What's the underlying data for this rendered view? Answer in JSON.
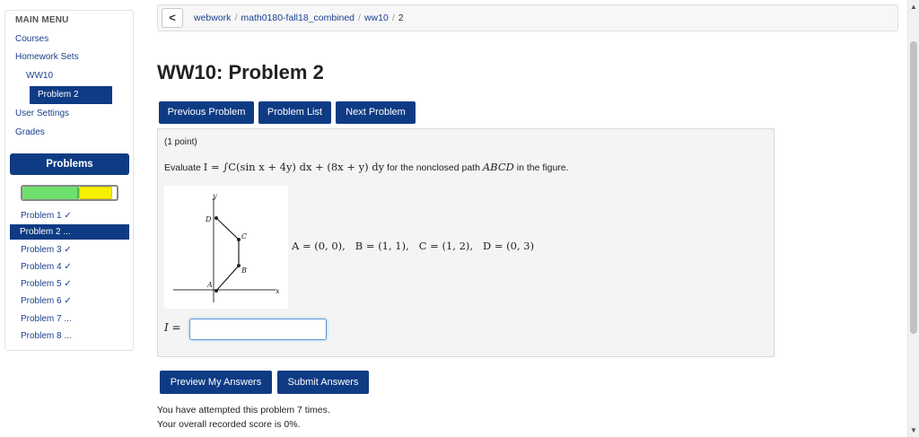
{
  "sidebar": {
    "menu_header": "MAIN MENU",
    "courses": "Courses",
    "homework_sets": "Homework Sets",
    "ww10": "WW10",
    "problem_active": "Problem 2",
    "user_settings": "User Settings",
    "grades": "Grades",
    "problems_header": "Problems",
    "progress": {
      "correct_fraction": 0.6,
      "attempted_fraction": 0.35,
      "correct_color": "#6ee06e",
      "attempted_color": "#f9f000"
    },
    "problems": [
      "Problem 1 ✓",
      "Problem 2 ...",
      "Problem 3 ✓",
      "Problem 4 ✓",
      "Problem 5 ✓",
      "Problem 6 ✓",
      "Problem 7 ...",
      "Problem 8 ..."
    ]
  },
  "breadcrumb": {
    "back_icon": "chevron-left-icon",
    "back_glyph": "<",
    "items": [
      "webwork",
      "math0180-fall18_combined",
      "ww10",
      "2"
    ],
    "separator": "/"
  },
  "page_title": "WW10: Problem 2",
  "nav": {
    "previous": "Previous Problem",
    "list": "Problem List",
    "next": "Next Problem"
  },
  "problem": {
    "points": "(1 point)",
    "statement_prefix": "Evaluate ",
    "statement_suffix": " for the nonclosed path ",
    "statement_end": " in the figure.",
    "math_integral": "I = ∫C(sin x + 4y) dx + (8x + y) dy",
    "path_name": "ABCD",
    "points_text": "A = (0, 0),   B = (1, 1),   C = (1, 2),   D = (0, 3)",
    "figure_labels": {
      "y_axis": "y",
      "x_axis": "x",
      "A": "A",
      "B": "B",
      "C": "C",
      "D": "D"
    },
    "answer_label": "I =",
    "answer_value": ""
  },
  "actions": {
    "preview": "Preview My Answers",
    "submit": "Submit Answers"
  },
  "status": {
    "attempts": "You have attempted this problem 7 times.",
    "score": "Your overall recorded score is 0%."
  },
  "colors": {
    "primary": "#0e3b84",
    "link": "#1a3f8f",
    "panel_bg": "#f4f4f4"
  }
}
